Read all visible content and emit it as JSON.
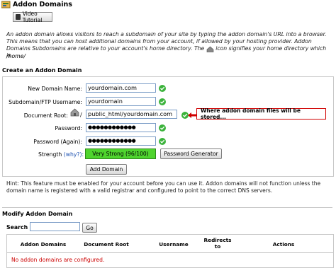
{
  "page": {
    "title": "Addon Domains"
  },
  "video_button": {
    "label": "Video Tutorial"
  },
  "description": {
    "line1": "An addon domain allows visitors to reach a subdomain of your site by typing the addon domain's URL into a browser. This means that you can host additional domains from your account, if allowed by your hosting provider. Addon Domains Subdomains are relative to your account's home directory. The",
    "line2": "icon signifies your home directory which is",
    "home": "/home/"
  },
  "create": {
    "heading": "Create an Addon Domain",
    "new_domain_label": "New Domain Name:",
    "new_domain_value": "yourdomain.com",
    "subdomain_label": "Subdomain/FTP Username:",
    "subdomain_value": "yourdomain",
    "docroot_label": "Document Root:",
    "docroot_prefix": "/",
    "docroot_value": "public_html/yourdomain.com",
    "password_label": "Password:",
    "password_value": "●●●●●●●●●●●●",
    "password_again_label": "Password (Again):",
    "password_again_value": "●●●●●●●●●●●●",
    "strength_label": "Strength",
    "strength_why": "(why?):",
    "strength_value": "Very Strong (96/100)",
    "strength_color": "#4fd42e",
    "generator_button": "Password Generator",
    "add_button": "Add Domain",
    "callout": "Where addon domain files will be stored..."
  },
  "hint": "Hint: This feature must be enabled for your account before you can use it. Addon domains will not function unless the domain name is registered with a valid registrar and configured to point to the correct DNS servers.",
  "modify": {
    "heading": "Modify Addon Domain",
    "search_label": "Search",
    "search_value": "",
    "go_button": "Go",
    "columns": [
      "Addon Domains",
      "Document Root",
      "Username",
      "Redirects to",
      "Actions"
    ],
    "empty_message": "No addon domains are configured."
  }
}
